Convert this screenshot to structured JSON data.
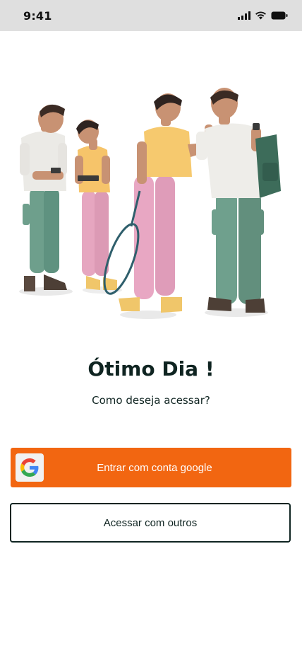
{
  "status_bar": {
    "time": "9:41",
    "icons": [
      "cellular-signal-icon",
      "wifi-icon",
      "battery-icon"
    ]
  },
  "hero": {
    "illustration": "four-people-standing-illustration"
  },
  "welcome": {
    "title": "Ótimo Dia !",
    "subtitle": "Como deseja acessar?"
  },
  "actions": {
    "google_label": "Entrar com conta google",
    "google_icon": "google-logo-icon",
    "others_label": "Acessar com outros"
  },
  "colors": {
    "accent": "#f26611",
    "text": "#0f2421",
    "status_bar_bg": "#dfdfdf"
  }
}
